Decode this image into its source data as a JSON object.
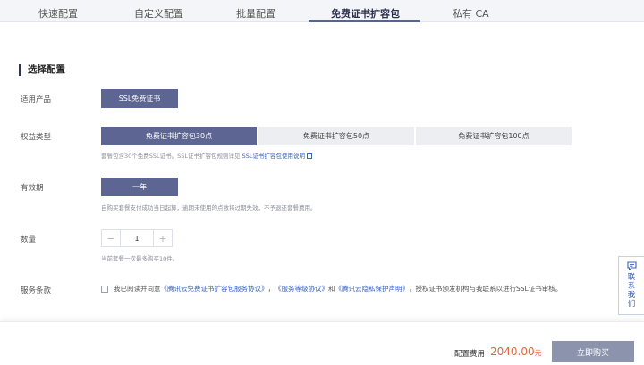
{
  "tabs": [
    {
      "label": "快速配置"
    },
    {
      "label": "自定义配置"
    },
    {
      "label": "批量配置"
    },
    {
      "label": "免费证书扩容包"
    },
    {
      "label": "私有 CA"
    }
  ],
  "active_tab_index": 3,
  "section_title": "选择配置",
  "product": {
    "label": "适用产品",
    "option": "SSL免费证书"
  },
  "benefit": {
    "label": "权益类型",
    "options": [
      "免费证书扩容包30点",
      "免费证书扩容包50点",
      "免费证书扩容包100点"
    ],
    "selected_index": 0,
    "hint": "套餐包含30个免费SSL证书。SSL证书扩容包规则详见 ",
    "hint_link": "SSL证书扩容包使用说明"
  },
  "validity": {
    "label": "有效期",
    "option": "一年",
    "hint": "自购买套餐支付成功当日起算，逾期未使用的点数将过期失效，不予退还套餐费用。"
  },
  "quantity": {
    "label": "数量",
    "value": "1",
    "minus": "−",
    "plus": "+",
    "hint": "当前套餐一次最多购买10件。"
  },
  "terms": {
    "label": "服务条款",
    "prefix": "我已阅读并同意",
    "link1": "《腾讯云免费证书扩容包服务协议》",
    "sep1": "，",
    "link2": "《服务等级协议》",
    "sep2": "和",
    "link3": "《腾讯云隐私保护声明》",
    "suffix": "，授权证书颁发机构与我联系以进行SSL证书审核。"
  },
  "contact": {
    "label": "联系我们",
    "icon": "chat-icon"
  },
  "footer": {
    "fee_label": "配置费用",
    "fee_amount": "2040.00",
    "fee_unit": "元",
    "buy_label": "立即购买"
  },
  "colors": {
    "accent": "#5d6692",
    "price": "#e8663a",
    "link": "#3a63b8"
  }
}
